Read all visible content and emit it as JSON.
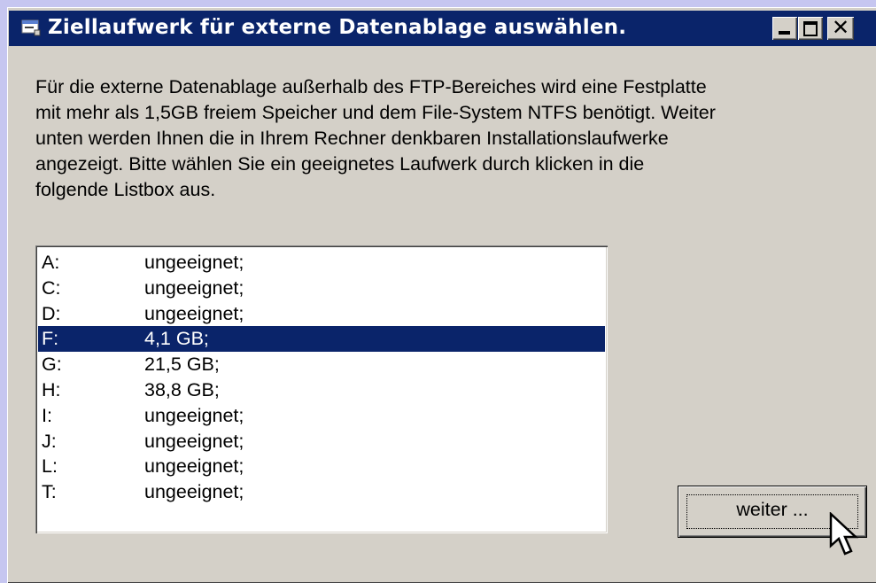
{
  "window": {
    "title": "Ziellaufwerk für externe Datenablage auswählen.",
    "controls": {
      "minimize": "_",
      "maximize": "□",
      "close": "✕"
    }
  },
  "description": {
    "lines": [
      "Für die externe Datenablage außerhalb des FTP-Bereiches wird eine Festplatte",
      "mit mehr als 1,5GB freiem Speicher und dem File-System NTFS benötigt. Weiter",
      "unten werden Ihnen die in Ihrem Rechner denkbaren Installationslaufwerke",
      "angezeigt. Bitte wählen Sie ein geeignetes Laufwerk durch klicken in die",
      "folgende Listbox aus."
    ]
  },
  "drive_list": {
    "selected": "F:",
    "items": [
      {
        "drive": "A:",
        "info": "ungeeignet;"
      },
      {
        "drive": "C:",
        "info": "ungeeignet;"
      },
      {
        "drive": "D:",
        "info": "ungeeignet;"
      },
      {
        "drive": "F:",
        "info": "4,1 GB;"
      },
      {
        "drive": "G:",
        "info": "21,5 GB;"
      },
      {
        "drive": "H:",
        "info": "38,8 GB;"
      },
      {
        "drive": "I:",
        "info": "ungeeignet;"
      },
      {
        "drive": "J:",
        "info": "ungeeignet;"
      },
      {
        "drive": "L:",
        "info": "ungeeignet;"
      },
      {
        "drive": "T:",
        "info": "ungeeignet;"
      }
    ]
  },
  "buttons": {
    "next_label": "weiter ..."
  },
  "colors": {
    "titlebar": "#0a246a",
    "selection": "#0a246a",
    "window_face": "#d4d0c8",
    "desktop": "#c6c6f0"
  },
  "icons": {
    "title": "app-window-icon",
    "cursor": "arrow-pointer-icon"
  }
}
